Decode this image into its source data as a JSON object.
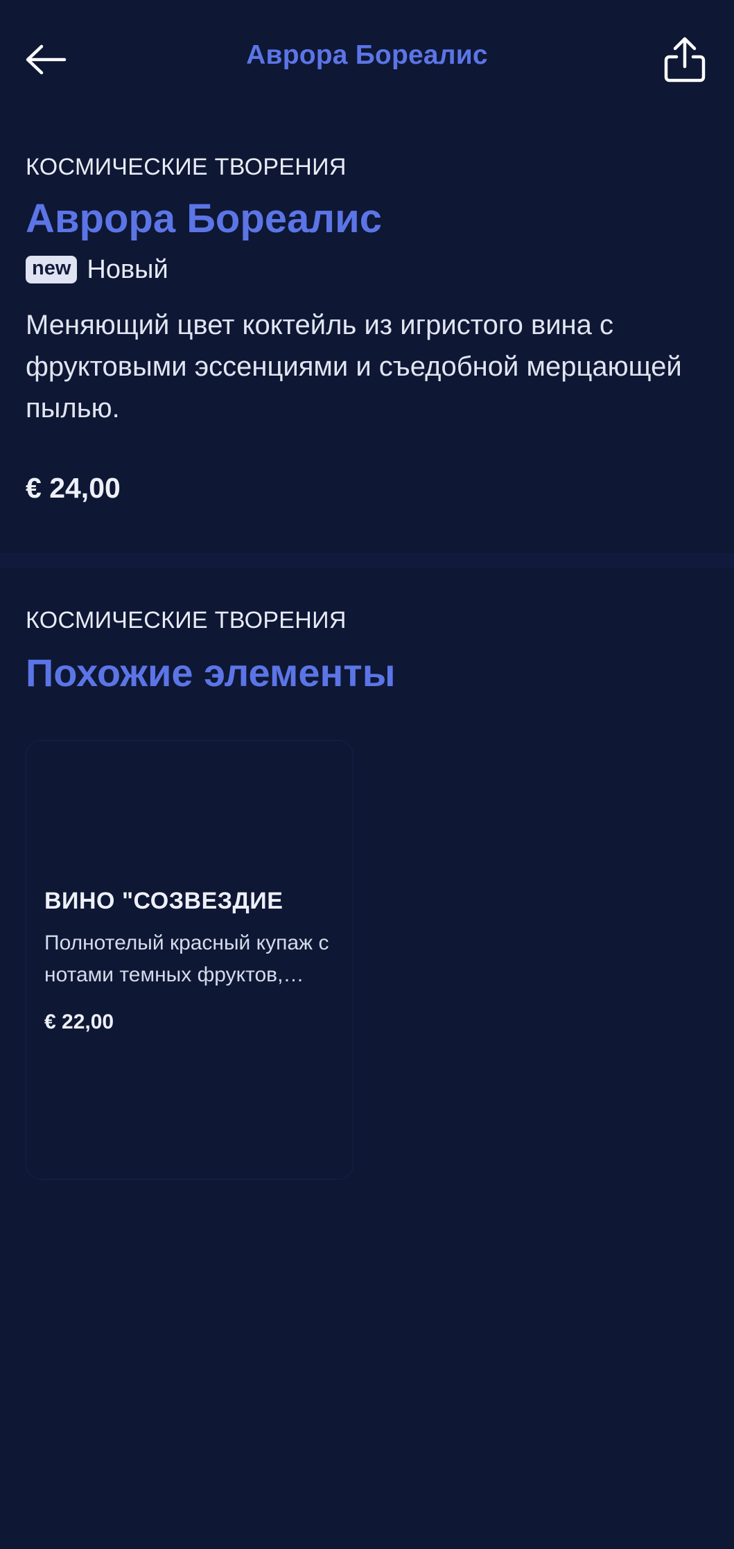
{
  "header": {
    "title": "Аврора Бореалис",
    "back_icon": "arrow-left-icon",
    "share_icon": "share-icon"
  },
  "product": {
    "category": "КОСМИЧЕСКИЕ ТВОРЕНИЯ",
    "title": "Аврора Бореалис",
    "badge": "new",
    "badge_label": "Новый",
    "description": "Меняющий цвет коктейль из игристого вина с фруктовыми эссенциями и съедобной мерцающей пылью.",
    "price": "€ 24,00"
  },
  "similar": {
    "category": "КОСМИЧЕСКИЕ ТВОРЕНИЯ",
    "title": "Похожие элементы",
    "items": [
      {
        "name": "ВИНО \"СОЗВЕЗДИЕ",
        "description": "Полнотелый красный купаж с нотами темных фруктов, пряностей и звездной пыли.",
        "price": "€ 22,00"
      }
    ]
  },
  "colors": {
    "background": "#0e1734",
    "accent": "#5c75e6",
    "text": "#e8ebf5"
  }
}
